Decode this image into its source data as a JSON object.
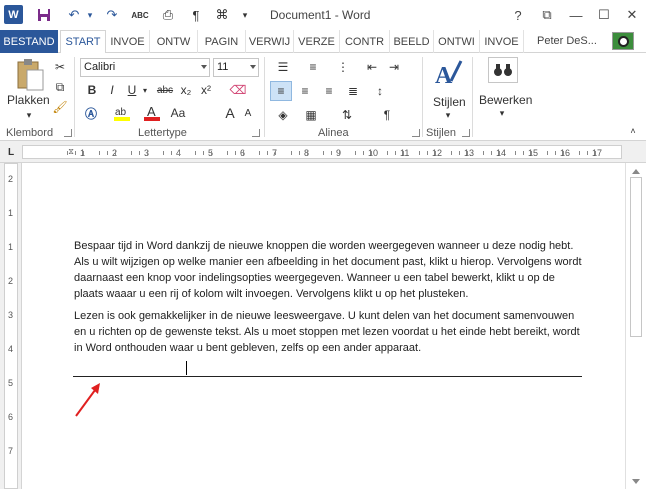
{
  "titlebar": {
    "word_logo": "W",
    "doc_title": "Document1 - Word",
    "help": "?",
    "restore": "⧉",
    "minimize": "—",
    "maximize": "☐",
    "close": "✕",
    "qa_icons": [
      "save-icon",
      "undo-icon",
      "redo-icon",
      "spelling-icon",
      "print-preview-icon",
      "pilcrow-icon",
      "attach-icon",
      "customize-icon"
    ]
  },
  "tabs": [
    "BESTAND",
    "START",
    "INVOE",
    "ONTW",
    "PAGIN",
    "VERWIJ",
    "VERZE",
    "CONTR",
    "BEELD",
    "ONTWI",
    "INVOE"
  ],
  "user": {
    "name": "Peter DeS..."
  },
  "ribbon": {
    "clipboard": {
      "paste_label": "Plakken",
      "group_label": "Klembord"
    },
    "font": {
      "font_name": "Calibri",
      "font_size": "11",
      "group_label": "Lettertype",
      "bold": "B",
      "italic": "I",
      "underline": "U",
      "strikethrough": "abc",
      "subscript": "x₂",
      "superscript": "x²",
      "grow": "A",
      "shrink": "A",
      "case": "Aa",
      "font_color": "A",
      "highlight_color": "#ffff00",
      "font_color_value": "#e02020"
    },
    "paragraph": {
      "group_label": "Alinea"
    },
    "styles": {
      "label": "Stijlen",
      "group_label": "Stijlen"
    },
    "editing": {
      "label": "Bewerken"
    }
  },
  "ruler": {
    "numbers": [
      "1",
      "2",
      "3",
      "4",
      "5",
      "6",
      "7",
      "8",
      "9",
      "10",
      "11",
      "12",
      "13",
      "14",
      "15",
      "16",
      "17"
    ]
  },
  "vruler": {
    "numbers": [
      "2",
      "1",
      "1",
      "2",
      "3",
      "4",
      "5",
      "6",
      "7"
    ]
  },
  "document": {
    "paragraphs": [
      "Bespaar tijd in Word dankzij de nieuwe knoppen die worden weergegeven wanneer u deze nodig hebt. Als u wilt wijzigen op welke manier een afbeelding in het document past, klikt u hierop. Vervolgens wordt daarnaast een knop voor indelingsopties weergegeven. Wanneer u een tabel bewerkt, klikt u op de plaats waaar u een rij of kolom wilt invoegen. Vervolgens klikt u op het plusteken.",
      "Lezen is ook gemakkelijker in de nieuwe leesweergave. U kunt delen van het document samenvouwen en u richten op de gewenste tekst. Als u moet stoppen met lezen voordat u het einde hebt bereikt, wordt in Word onthouden waar u bent gebleven, zelfs op een ander apparaat."
    ]
  },
  "colors": {
    "brand": "#2b579a",
    "arrow": "#e02020"
  }
}
